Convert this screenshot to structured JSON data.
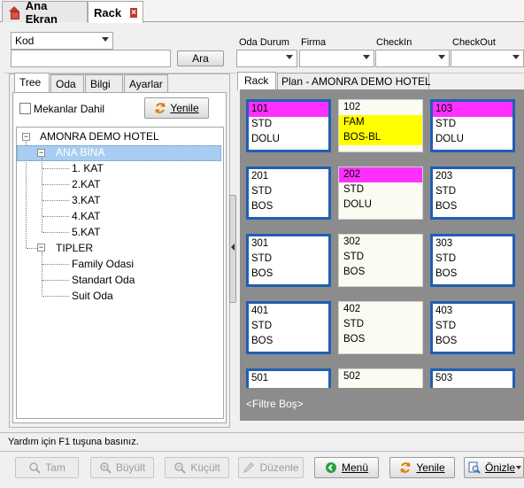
{
  "doc_tabs": [
    {
      "label": "Ana Ekran",
      "icon": "home-icon"
    },
    {
      "label": "Rack",
      "icon": "close-icon"
    }
  ],
  "filters": {
    "kod": "Kod",
    "ara": "Ara",
    "oda_durum": "Oda Durum",
    "firma": "Firma",
    "checkin": "CheckIn",
    "checkout": "CheckOut"
  },
  "left_tabs": [
    "Tree",
    "Oda",
    "Bilgi",
    "Ayarlar"
  ],
  "mekanlar_dahil": "Mekanlar Dahil",
  "yenile": "Yenile",
  "tree": {
    "root": "AMONRA DEMO HOTEL",
    "bina": "ANA BİNA",
    "katlar": [
      "1. KAT",
      "2.KAT",
      "3.KAT",
      "4.KAT",
      "5.KAT"
    ],
    "tipler": "TIPLER",
    "tip_items": [
      "Family Odasi",
      "Standart Oda",
      "Suit Oda"
    ]
  },
  "right_tabs": [
    "Rack",
    "Plan - AMONRA DEMO HOTEL"
  ],
  "rooms": [
    {
      "no": "101",
      "type": "STD",
      "status": "DOLU",
      "style": "blue",
      "no_bg": "#ff30ff",
      "mid_bg": "",
      "bot_bg": ""
    },
    {
      "no": "102",
      "type": "FAM",
      "status": "BOS-BL",
      "style": "plain",
      "no_bg": "",
      "mid_bg": "#ffff00",
      "bot_bg": "#ffff00"
    },
    {
      "no": "103",
      "type": "STD",
      "status": "DOLU",
      "style": "blue",
      "no_bg": "#ff30ff",
      "mid_bg": "",
      "bot_bg": ""
    },
    {
      "no": "201",
      "type": "STD",
      "status": "BOS",
      "style": "blue",
      "no_bg": "",
      "mid_bg": "",
      "bot_bg": ""
    },
    {
      "no": "202",
      "type": "STD",
      "status": "DOLU",
      "style": "plain",
      "no_bg": "#ff30ff",
      "mid_bg": "",
      "bot_bg": ""
    },
    {
      "no": "203",
      "type": "STD",
      "status": "BOS",
      "style": "blue",
      "no_bg": "",
      "mid_bg": "",
      "bot_bg": ""
    },
    {
      "no": "301",
      "type": "STD",
      "status": "BOS",
      "style": "blue",
      "no_bg": "",
      "mid_bg": "",
      "bot_bg": ""
    },
    {
      "no": "302",
      "type": "STD",
      "status": "BOS",
      "style": "plain",
      "no_bg": "",
      "mid_bg": "",
      "bot_bg": ""
    },
    {
      "no": "303",
      "type": "STD",
      "status": "BOS",
      "style": "blue",
      "no_bg": "",
      "mid_bg": "",
      "bot_bg": ""
    },
    {
      "no": "401",
      "type": "STD",
      "status": "BOS",
      "style": "blue",
      "no_bg": "",
      "mid_bg": "",
      "bot_bg": ""
    },
    {
      "no": "402",
      "type": "STD",
      "status": "BOS",
      "style": "plain",
      "no_bg": "",
      "mid_bg": "",
      "bot_bg": ""
    },
    {
      "no": "403",
      "type": "STD",
      "status": "BOS",
      "style": "blue",
      "no_bg": "",
      "mid_bg": "",
      "bot_bg": ""
    },
    {
      "no": "501",
      "type": "",
      "status": "",
      "style": "blue",
      "no_bg": "",
      "mid_bg": "",
      "bot_bg": ""
    },
    {
      "no": "502",
      "type": "",
      "status": "",
      "style": "plain",
      "no_bg": "",
      "mid_bg": "",
      "bot_bg": ""
    },
    {
      "no": "503",
      "type": "",
      "status": "",
      "style": "blue",
      "no_bg": "",
      "mid_bg": "",
      "bot_bg": ""
    }
  ],
  "filter_status": "<Filtre Boş>",
  "statusbar": "Yardım için F1 tuşuna basınız.",
  "bottom_buttons": {
    "tam": "Tam",
    "buyult": "Büyült",
    "kucult": "Küçült",
    "duzenle": "Düzenle",
    "menu": "Menü",
    "yenile": "Yenile",
    "onizle": "Önizle"
  },
  "colors": {
    "room_border": "#1f5fb4",
    "occupied": "#ff30ff",
    "blocked": "#ffff00",
    "selection": "#a8cdf0"
  }
}
